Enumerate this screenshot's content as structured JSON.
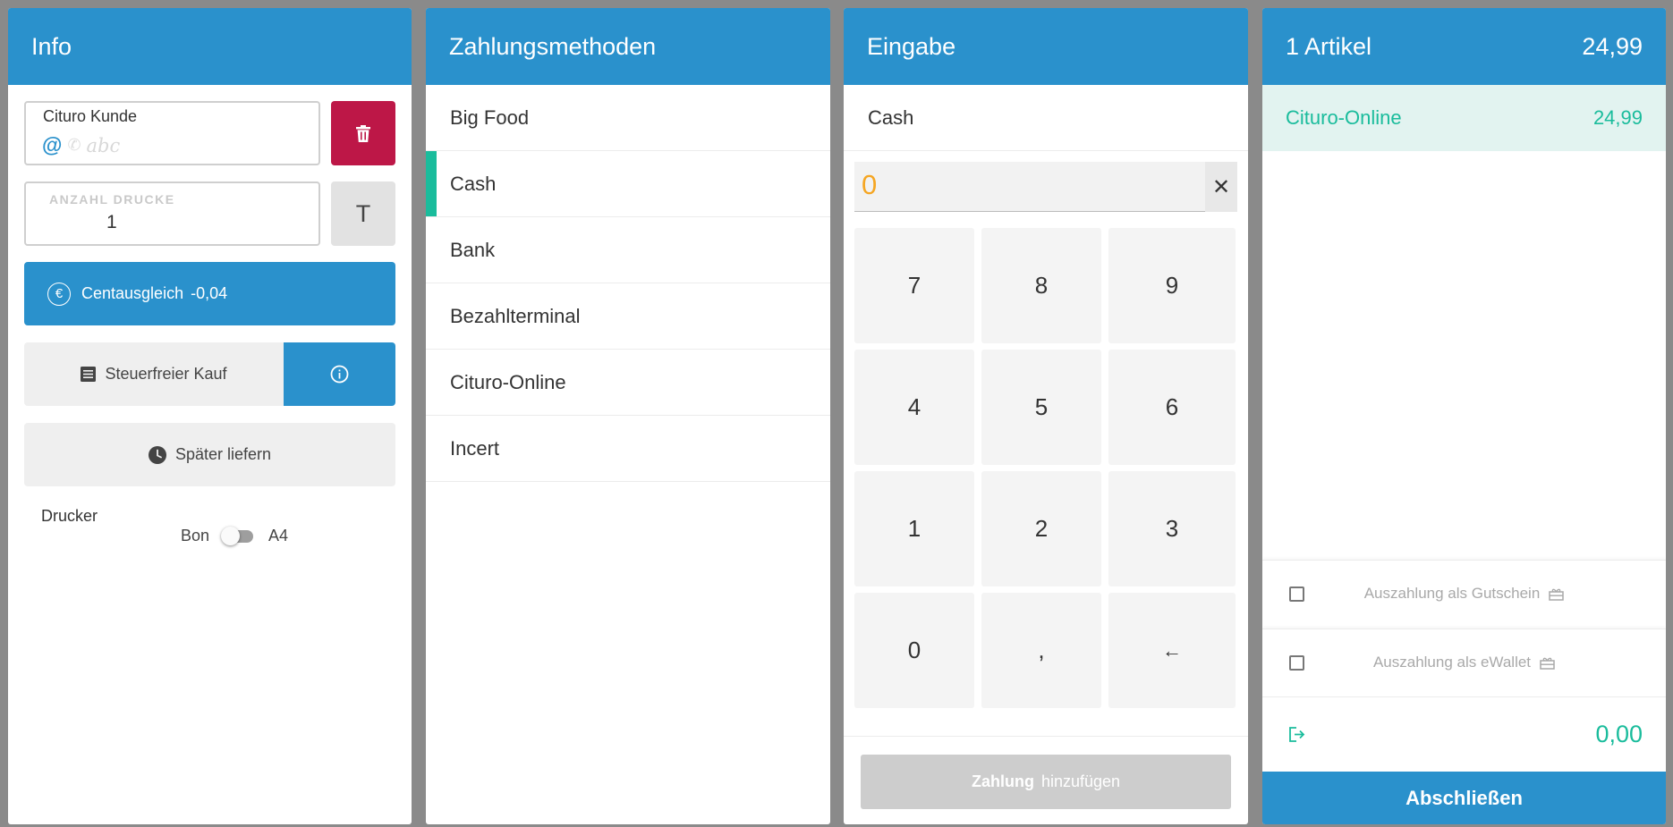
{
  "info": {
    "title": "Info",
    "kunde_label": "Cituro Kunde",
    "kunde_at": "@",
    "kunde_placeholder": "abc",
    "drucke_label": "ANZAHL DRUCKE",
    "drucke_value": "1",
    "t_button": "T",
    "cent_label": "Centausgleich",
    "cent_value": "-0,04",
    "euro_symbol": "€",
    "steuer_label": "Steuerfreier Kauf",
    "spaeter_label": "Später liefern",
    "drucker_label": "Drucker",
    "toggle_left": "Bon",
    "toggle_right": "A4"
  },
  "methods": {
    "title": "Zahlungsmethoden",
    "items": [
      {
        "label": "Big Food"
      },
      {
        "label": "Cash"
      },
      {
        "label": "Bank"
      },
      {
        "label": "Bezahlterminal"
      },
      {
        "label": "Cituro-Online"
      },
      {
        "label": "Incert"
      }
    ],
    "active": "Cash"
  },
  "input": {
    "title": "Eingabe",
    "selected_method": "Cash",
    "amount": "0",
    "keys": [
      "7",
      "8",
      "9",
      "4",
      "5",
      "6",
      "1",
      "2",
      "3",
      "0",
      ",",
      "←"
    ],
    "add_bold": "Zahlung",
    "add_rest": "hinzufügen"
  },
  "cart": {
    "title": "1 Artikel",
    "total": "24,99",
    "items": [
      {
        "name": "Cituro-Online",
        "amount": "24,99"
      }
    ],
    "option_gutschein": "Auszahlung als Gutschein",
    "option_ewallet": "Auszahlung als eWallet",
    "change_value": "0,00",
    "finish_label": "Abschließen"
  },
  "colors": {
    "header_blue": "#2a91cc",
    "delete_red": "#bd1747",
    "accent_teal": "#1abc9c",
    "amount_orange": "#f5a623"
  },
  "icons": {
    "delete": "trash-icon",
    "info": "info-circle-icon",
    "receipt": "receipt-icon",
    "clock": "clock-icon",
    "clear": "close-icon",
    "backspace": "arrow-left-icon",
    "gift": "gift-icon",
    "exit": "exit-icon"
  }
}
